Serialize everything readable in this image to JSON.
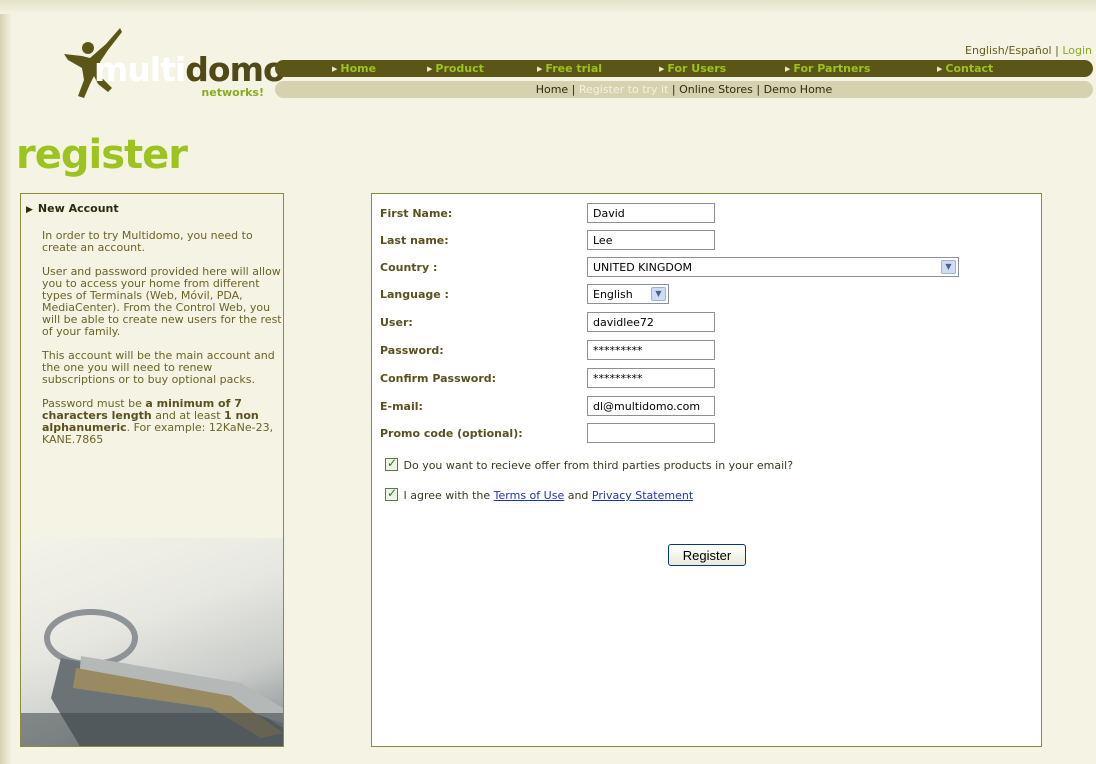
{
  "header": {
    "lang_label": "English/Español",
    "login_label": "Login",
    "logo_text_light": "multi",
    "logo_text_dark": "domo",
    "logo_sub": "networks!"
  },
  "nav_main": [
    "Home",
    "Product",
    "Free trial",
    "For Users",
    "For Partners",
    "Contact"
  ],
  "nav_sub": {
    "home": "Home",
    "register": "Register to try it",
    "stores": "Online Stores",
    "demo": "Demo Home"
  },
  "page_title": "register",
  "sidebar": {
    "heading": "New Account",
    "p1": "In order to try Multidomo, you need to create an account.",
    "p2": "User and password provided here will allow you to access your home from different types of Terminals (Web, Móvil, PDA, MediaCenter). From the Control Web, you will be able to create new users for the rest of your family.",
    "p3": "This account will be the main account and the one you will need to renew subscriptions or to buy optional packs.",
    "p4_a": "Password must be ",
    "p4_b": "a minimum of 7 characters length",
    "p4_c": " and at least ",
    "p4_d": "1 non alphanumeric",
    "p4_e": ". For example: 12KaNe-23, KANE.7865"
  },
  "form": {
    "first_name_label": "First Name:",
    "first_name": "David",
    "last_name_label": "Last name:",
    "last_name": "Lee",
    "country_label": "Country :",
    "country": "UNITED KINGDOM",
    "language_label": "Language :",
    "language": "English",
    "user_label": "User:",
    "user": "davidlee72",
    "password_label": "Password:",
    "password": "*********",
    "confirm_label": "Confirm Password:",
    "confirm": "*********",
    "email_label": "E-mail:",
    "email": "dl@multidomo.com",
    "promo_label": "Promo code (optional):",
    "promo": "",
    "offers_label": "Do you want to recieve offer from third parties products in your email?",
    "agree_prefix": "I agree with the ",
    "terms_link": "Terms of Use",
    "and_text": " and ",
    "privacy_link": "Privacy Statement",
    "register_button": "Register"
  }
}
